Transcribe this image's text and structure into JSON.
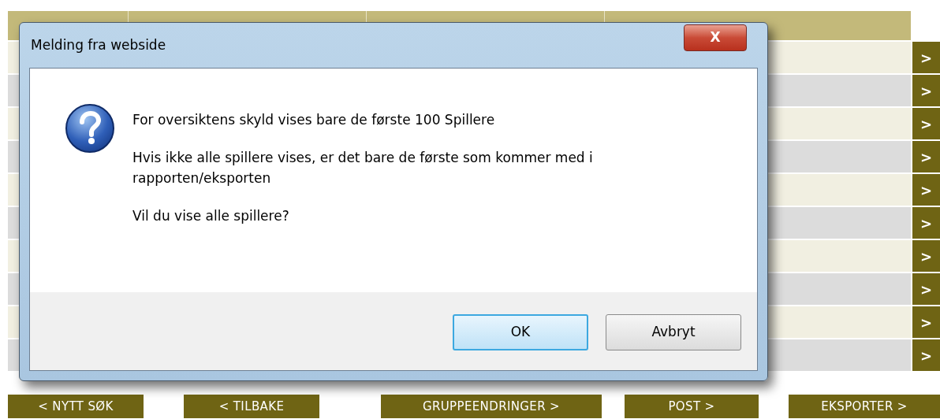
{
  "table": {
    "rows": [
      {
        "action": ">"
      },
      {
        "action": ">"
      },
      {
        "action": ">"
      },
      {
        "action": ">"
      },
      {
        "action": ">"
      },
      {
        "action": ">"
      },
      {
        "action": ">"
      },
      {
        "action": ">"
      },
      {
        "action": ">"
      },
      {
        "action": ">"
      }
    ]
  },
  "buttons": [
    "< NYTT SØK",
    "< TILBAKE",
    "GRUPPEENDRINGER >",
    "POST >",
    "EKSPORTER >"
  ],
  "dialog": {
    "title": "Melding fra webside",
    "close": "X",
    "paragraphs": [
      "For oversiktens skyld vises bare de første 100 Spillere",
      "Hvis ikke alle spillere vises, er det bare de første som kommer med i rapporten/eksporten",
      "Vil du vise alle spillere?"
    ],
    "buttons": [
      {
        "label": "OK",
        "selected": true
      },
      {
        "label": "Avbryt",
        "selected": false
      }
    ]
  }
}
